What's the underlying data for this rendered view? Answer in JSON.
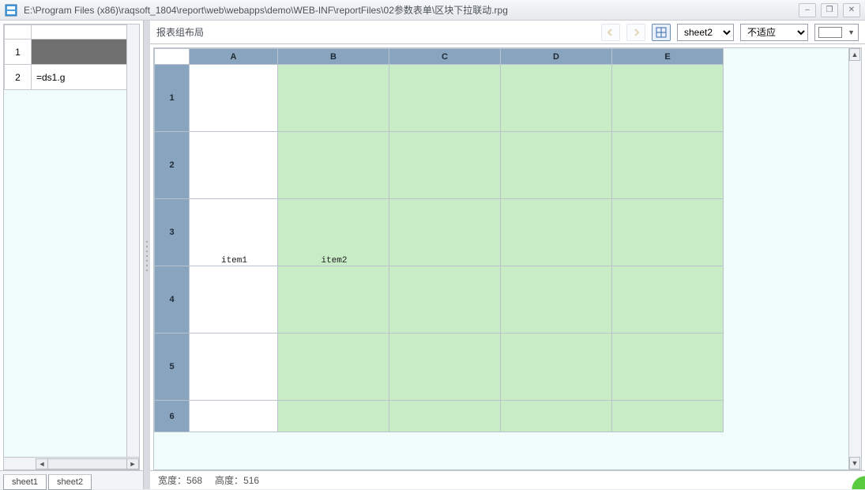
{
  "title_path": "E:\\Program Files (x86)\\raqsoft_1804\\report\\web\\webapps\\demo\\WEB-INF\\reportFiles\\02参数表单\\区块下拉联动.rpg",
  "toolbar": {
    "layout_label": "报表组布局",
    "sheet_select": "sheet2",
    "fit_select": "不适应"
  },
  "left_panel": {
    "row1": "1",
    "row2": "2",
    "cell2": "=ds1.g",
    "tabs": [
      "sheet1",
      "sheet2"
    ]
  },
  "grid": {
    "columns": [
      "A",
      "B",
      "C",
      "D",
      "E"
    ],
    "rows": [
      "1",
      "2",
      "3",
      "4",
      "5",
      "6"
    ],
    "a3_overflow": "item1",
    "b3_overflow": "item2"
  },
  "status": {
    "width_label": "宽度：",
    "width_value": "568",
    "height_label": "高度：",
    "height_value": "516"
  }
}
